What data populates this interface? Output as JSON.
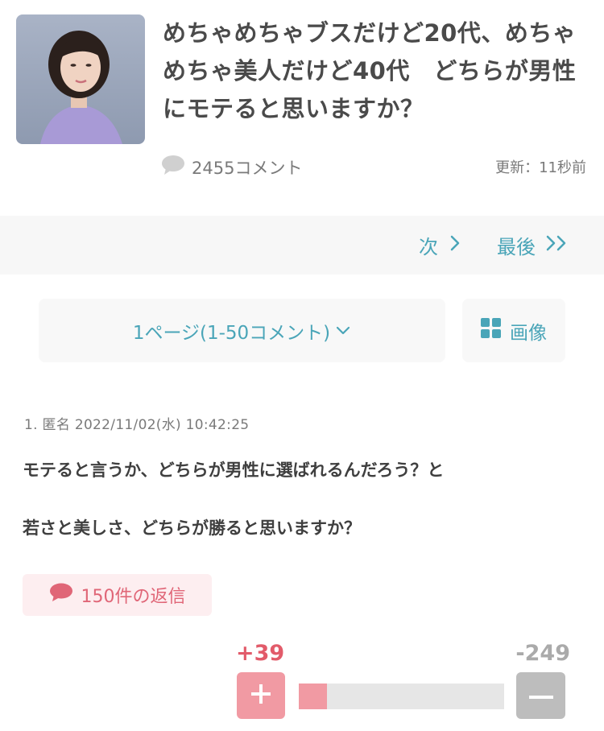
{
  "topic": {
    "title": "めちゃめちゃブスだけど20代、めちゃめちゃ美人だけど40代　どちらが男性にモテると思いますか？",
    "comment_count": "2455コメント",
    "updated": "更新：11秒前"
  },
  "nav": {
    "next_label": "次",
    "last_label": "最後"
  },
  "pager": {
    "page_label": "1ページ(1-50コメント)",
    "image_label": "画像"
  },
  "comment": {
    "meta": "1. 匿名 2022/11/02(水) 10:42:25",
    "line1": "モテると言うか、どちらが男性に選ばれるんだろう？と",
    "line2": "若さと美しさ、どちらが勝ると思いますか？",
    "reply_label": "150件の返信",
    "plus_count": "+39",
    "minus_count": "-249",
    "plus_value": 39,
    "minus_value": 249
  },
  "colors": {
    "accent": "#4aa5b8",
    "plus": "#e25b6a",
    "plus_light": "#f19aa3",
    "minus": "#bdbdbd"
  },
  "icons": {
    "comment": "speech-bubble-icon",
    "next": "chevron-right-icon",
    "last": "double-chevron-right-icon",
    "dropdown": "chevron-down-icon",
    "image": "grid-icon",
    "reply": "speech-bubble-icon",
    "plus": "plus-icon",
    "minus": "minus-icon"
  }
}
